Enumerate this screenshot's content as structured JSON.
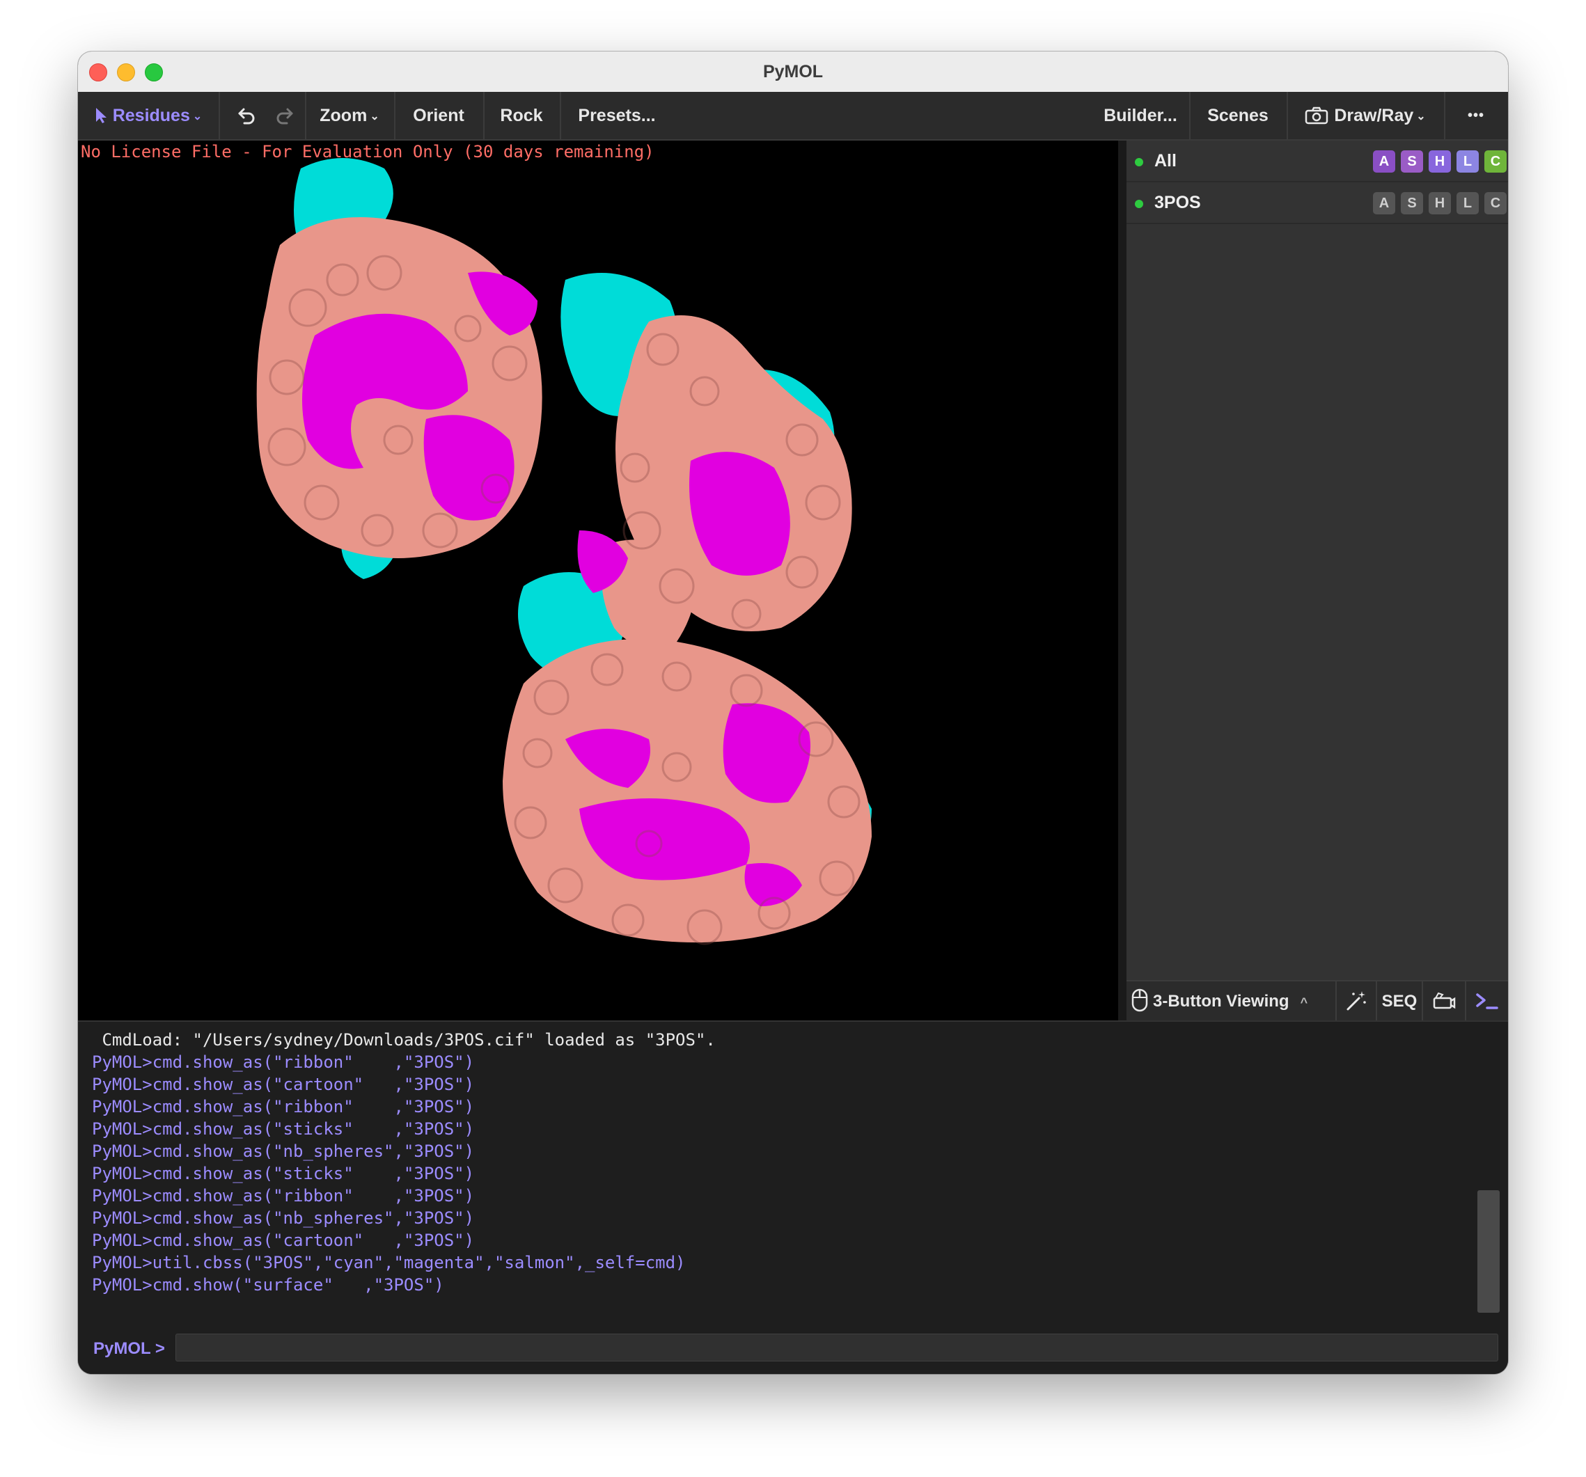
{
  "window": {
    "title": "PyMOL"
  },
  "toolbar": {
    "residues_label": "Residues",
    "zoom_label": "Zoom",
    "orient_label": "Orient",
    "rock_label": "Rock",
    "presets_label": "Presets...",
    "builder_label": "Builder...",
    "scenes_label": "Scenes",
    "drawray_label": "Draw/Ray",
    "more_label": "•••"
  },
  "viewport": {
    "license_text": "No License File - For Evaluation Only (30 days remaining)",
    "colors": {
      "cyan": "#00e5e0",
      "magenta": "#e100e0",
      "salmon": "#e8968a"
    }
  },
  "objects": [
    {
      "name": "All",
      "buttons": [
        "A",
        "S",
        "H",
        "L",
        "C"
      ]
    },
    {
      "name": "3POS",
      "buttons": [
        "A",
        "S",
        "H",
        "L",
        "C"
      ]
    }
  ],
  "panel_bar": {
    "viewing_label": "3-Button Viewing",
    "seq_label": "SEQ"
  },
  "console": {
    "lines": [
      " CmdLoad: \"/Users/sydney/Downloads/3POS.cif\" loaded as \"3POS\".",
      "PyMOL>cmd.show_as(\"ribbon\"    ,\"3POS\")",
      "PyMOL>cmd.show_as(\"cartoon\"   ,\"3POS\")",
      "PyMOL>cmd.show_as(\"ribbon\"    ,\"3POS\")",
      "PyMOL>cmd.show_as(\"sticks\"    ,\"3POS\")",
      "PyMOL>cmd.show_as(\"nb_spheres\",\"3POS\")",
      "PyMOL>cmd.show_as(\"sticks\"    ,\"3POS\")",
      "PyMOL>cmd.show_as(\"ribbon\"    ,\"3POS\")",
      "PyMOL>cmd.show_as(\"nb_spheres\",\"3POS\")",
      "PyMOL>cmd.show_as(\"cartoon\"   ,\"3POS\")",
      "PyMOL>util.cbss(\"3POS\",\"cyan\",\"magenta\",\"salmon\",_self=cmd)",
      "PyMOL>cmd.show(\"surface\"   ,\"3POS\")"
    ],
    "prompt_label": "PyMOL >",
    "input_value": ""
  }
}
